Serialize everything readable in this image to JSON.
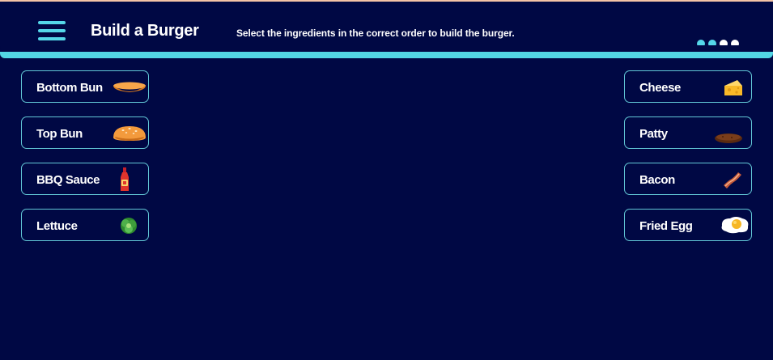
{
  "header": {
    "title": "Build a Burger",
    "instructions": "Select the ingredients in the correct order to build the burger."
  },
  "progress": {
    "total": 4,
    "completed": 2
  },
  "ingredients_left": [
    {
      "label": "Bottom Bun",
      "icon": "bottom-bun-icon"
    },
    {
      "label": "Top Bun",
      "icon": "top-bun-icon"
    },
    {
      "label": "BBQ Sauce",
      "icon": "bbq-sauce-icon"
    },
    {
      "label": "Lettuce",
      "icon": "lettuce-icon"
    }
  ],
  "ingredients_right": [
    {
      "label": "Cheese",
      "icon": "cheese-icon"
    },
    {
      "label": "Patty",
      "icon": "patty-icon"
    },
    {
      "label": "Bacon",
      "icon": "bacon-icon"
    },
    {
      "label": "Fried Egg",
      "icon": "fried-egg-icon"
    }
  ],
  "colors": {
    "background": "#000844",
    "accent": "#55d7e9",
    "border": "#62c7d6",
    "text": "#ffffff"
  }
}
